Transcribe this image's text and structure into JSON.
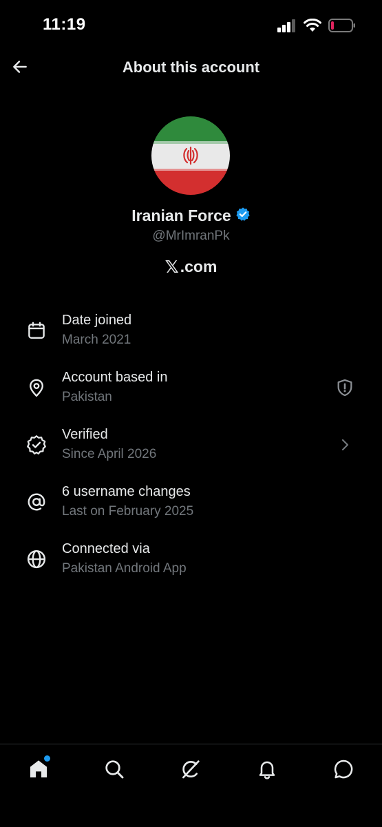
{
  "status_bar": {
    "time": "11:19"
  },
  "header": {
    "title": "About this account"
  },
  "profile": {
    "display_name": "Iranian Force",
    "handle": "@MrImranPk",
    "platform_symbol": "𝕏",
    "platform_domain": ".com"
  },
  "info_items": [
    {
      "icon": "calendar-icon",
      "title": "Date joined",
      "subtitle": "March 2021"
    },
    {
      "icon": "location-pin-icon",
      "title": "Account based in",
      "subtitle": "Pakistan",
      "trailing_icon": "shield-alert-icon"
    },
    {
      "icon": "verified-badge-icon",
      "title": "Verified",
      "subtitle": "Since April 2026",
      "trailing_icon": "chevron-right-icon"
    },
    {
      "icon": "at-sign-icon",
      "title": "6 username changes",
      "subtitle": "Last on February 2025"
    },
    {
      "icon": "globe-icon",
      "title": "Connected via",
      "subtitle": "Pakistan Android App"
    }
  ],
  "bottom_nav": [
    {
      "icon": "home-icon",
      "active": true,
      "has_notification_dot": true
    },
    {
      "icon": "search-icon"
    },
    {
      "icon": "grok-icon"
    },
    {
      "icon": "bell-icon"
    },
    {
      "icon": "chat-icon"
    }
  ],
  "colors": {
    "background": "#000000",
    "primary_text": "#e7e9ea",
    "secondary_text": "#71767b",
    "accent": "#1d9bf0",
    "divider": "#2f3336",
    "battery_low": "#e0245e"
  }
}
